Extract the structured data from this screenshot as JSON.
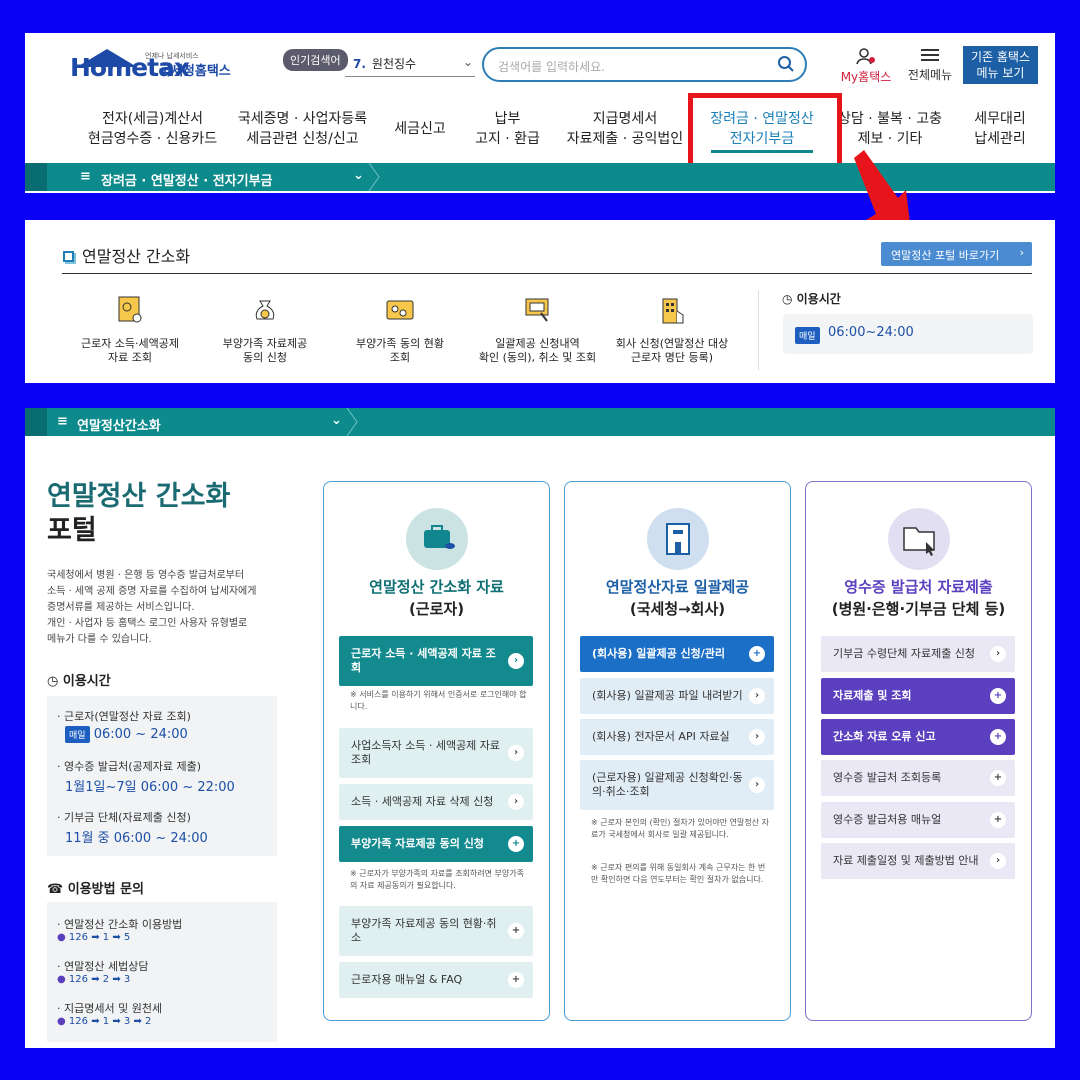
{
  "header": {
    "logo_text": "Hometax",
    "logo_small": "언제나 납세서비스",
    "logo_korean": "국세청홈택스",
    "popular_badge": "인기검색어",
    "popular_rank": "7.",
    "popular_term": "원천징수",
    "search_placeholder": "검색어를 입력하세요.",
    "my_label": "My홈택스",
    "menu_label": "전체메뉴",
    "old_button_line1": "기존 홈택스",
    "old_button_line2": "메뉴 보기"
  },
  "nav": [
    {
      "line1": "전자(세금)계산서",
      "line2": "현금영수증 · 신용카드"
    },
    {
      "line1": "국세증명 · 사업자등록",
      "line2": "세금관련 신청/신고"
    },
    {
      "line1": "세금신고",
      "line2": ""
    },
    {
      "line1": "납부",
      "line2": "고지 · 환급"
    },
    {
      "line1": "지급명세서",
      "line2": "자료제출 · 공익법인"
    },
    {
      "line1": "장려금 · 연말정산",
      "line2": "전자기부금"
    },
    {
      "line1": "상담 · 불복 · 고충",
      "line2": "제보 · 기타"
    },
    {
      "line1": "세무대리",
      "line2": "납세관리"
    }
  ],
  "breadcrumb1": "장려금 · 연말정산 · 전자기부금",
  "section2": {
    "title": "연말정산 간소화",
    "portal_button": "연말정산 포털 바로가기",
    "services": [
      {
        "line1": "근로자 소득·세액공제",
        "line2": "자료 조회"
      },
      {
        "line1": "부양가족 자료제공",
        "line2": "동의 신청"
      },
      {
        "line1": "부양가족 동의 현황",
        "line2": "조회"
      },
      {
        "line1": "일괄제공 신청내역",
        "line2": "확인 (동의), 취소 및 조회"
      },
      {
        "line1": "회사 신청(연말정산 대상",
        "line2": "근로자 명단 등록)"
      }
    ],
    "use_time_label": "이용시간",
    "daily_badge": "매일",
    "time": "06:00~24:00"
  },
  "breadcrumb2": "연말정산간소화",
  "portal": {
    "title_line1": "연말정산 간소화",
    "title_line2": "포털",
    "desc": [
      "국세청에서 병원 · 은행 등 영수증 발급처로부터",
      "소득 · 세액 공제 증명 자료를 수집하여 납세자에게",
      "증명서류를 제공하는 서비스입니다.",
      "개인 · 사업자 등 홈택스 로그인 사용자 유형별로",
      "메뉴가 다를 수 있습니다."
    ],
    "use_time_label": "이용시간",
    "times": [
      {
        "label": "· 근로자(연말정산 자료 조회)",
        "badge": "매일",
        "value": "06:00 ~ 24:00"
      },
      {
        "label": "· 영수증 발급처(공제자료 제출)",
        "badge": "",
        "value": "1월1일~7일 06:00 ~ 22:00"
      },
      {
        "label": "· 기부금 단체(자료제출 신청)",
        "badge": "",
        "value": "11월 중 06:00 ~ 24:00"
      }
    ],
    "inquiry_label": "이용방법 문의",
    "inquiries": [
      {
        "label": "· 연말정산 간소화 이용방법",
        "steps": [
          "126",
          "1",
          "5"
        ]
      },
      {
        "label": "· 연말정산 세법상담",
        "steps": [
          "126",
          "2",
          "3"
        ]
      },
      {
        "label": "· 지급명세서 및 원천세",
        "steps": [
          "126",
          "1",
          "3",
          "2"
        ]
      }
    ]
  },
  "cards": [
    {
      "title1": "연말정산 간소화 자료",
      "title2": "(근로자)",
      "items": [
        {
          "text": "근로자 소득 · 세액공제 자료 조회",
          "style": "primary"
        },
        {
          "text": "※ 서비스를 이용하기 위해서 인증서로 로그인해야 합니다.",
          "style": "note"
        },
        {
          "text": "사업소득자 소득 · 세액공제 자료 조회",
          "style": "light"
        },
        {
          "text": "소득 · 세액공제 자료 삭제 신청",
          "style": "light"
        },
        {
          "text": "부양가족 자료제공 동의 신청",
          "style": "primary"
        },
        {
          "text": "※ 근로자가 부양가족의 자료를 조회하려면 부양가족의 자료 제공동의가 필요합니다.",
          "style": "note"
        },
        {
          "text": "부양가족 자료제공 동의 현황·취소",
          "style": "light"
        },
        {
          "text": "근로자용 매뉴얼 & FAQ",
          "style": "light"
        }
      ]
    },
    {
      "title1": "연말정산자료 일괄제공",
      "title2": "(국세청→회사)",
      "items": [
        {
          "text": "(회사용) 일괄제공 신청/관리",
          "style": "primary"
        },
        {
          "text": "(회사용) 일괄제공 파일 내려받기",
          "style": "light"
        },
        {
          "text": "(회사용) 전자문서 API 자료실",
          "style": "light"
        },
        {
          "text": "(근로자용) 일괄제공 신청확인·동의·취소·조회",
          "style": "light"
        },
        {
          "text": "※ 근로자 본인의 (확인) 절차가 있어야만 연말정산 자료가 국세청에서 회사로 일괄 제공됩니다.",
          "style": "note"
        },
        {
          "text": "※ 근로자 편의를 위해 동일회사 계속 근무자는 한 번만 확인하면 다음 연도부터는 확인 절차가 없습니다.",
          "style": "note"
        }
      ]
    },
    {
      "title1": "영수증 발급처 자료제출",
      "title2": "(병원·은행·기부금 단체 등)",
      "items": [
        {
          "text": "기부금 수령단체 자료제출 신청",
          "style": "light"
        },
        {
          "text": "자료제출 및 조회",
          "style": "primary"
        },
        {
          "text": "간소화 자료 오류 신고",
          "style": "primary"
        },
        {
          "text": "영수증 발급처 조회등록",
          "style": "light"
        },
        {
          "text": "영수증 발급처용 매뉴얼",
          "style": "light"
        },
        {
          "text": "자료 제출일정 및 제출방법 안내",
          "style": "light"
        }
      ]
    }
  ],
  "colors": {
    "teal": "#0d8a8c",
    "blue": "#1c6fc7",
    "purple": "#5a3fbf",
    "highlight": "#e8141b",
    "background": "#0a00f5"
  }
}
